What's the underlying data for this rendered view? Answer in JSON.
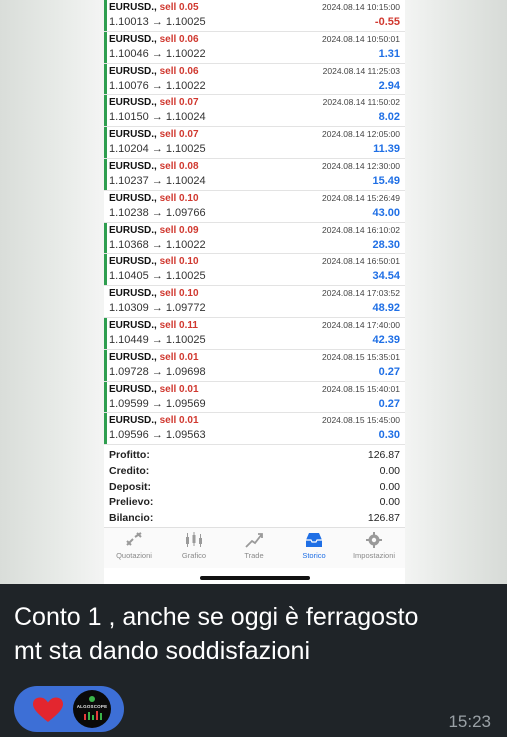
{
  "trades": [
    {
      "symbol": "EURUSD.,",
      "side": "sell 0.05",
      "prices": "1.10013 → 1.10025",
      "date": "2024.08.14 10:15:00",
      "profit": "-0.55",
      "profit_color": "#d0382f",
      "bar_color": "#2e9e4f"
    },
    {
      "symbol": "EURUSD.,",
      "side": "sell 0.06",
      "prices": "1.10046 → 1.10022",
      "date": "2024.08.14 10:50:01",
      "profit": "1.31",
      "profit_color": "#1f6fe5",
      "bar_color": "#2e9e4f"
    },
    {
      "symbol": "EURUSD.,",
      "side": "sell 0.06",
      "prices": "1.10076 → 1.10022",
      "date": "2024.08.14 11:25:03",
      "profit": "2.94",
      "profit_color": "#1f6fe5",
      "bar_color": "#2e9e4f"
    },
    {
      "symbol": "EURUSD.,",
      "side": "sell 0.07",
      "prices": "1.10150 → 1.10024",
      "date": "2024.08.14 11:50:02",
      "profit": "8.02",
      "profit_color": "#1f6fe5",
      "bar_color": "#2e9e4f"
    },
    {
      "symbol": "EURUSD.,",
      "side": "sell 0.07",
      "prices": "1.10204 → 1.10025",
      "date": "2024.08.14 12:05:00",
      "profit": "11.39",
      "profit_color": "#1f6fe5",
      "bar_color": "#2e9e4f"
    },
    {
      "symbol": "EURUSD.,",
      "side": "sell 0.08",
      "prices": "1.10237 → 1.10024",
      "date": "2024.08.14 12:30:00",
      "profit": "15.49",
      "profit_color": "#1f6fe5",
      "bar_color": "#2e9e4f"
    },
    {
      "symbol": "EURUSD.,",
      "side": "sell 0.10",
      "prices": "1.10238 → 1.09766",
      "date": "2024.08.14 15:26:49",
      "profit": "43.00",
      "profit_color": "#1f6fe5",
      "bar_color": "#ffffff"
    },
    {
      "symbol": "EURUSD.,",
      "side": "sell 0.09",
      "prices": "1.10368 → 1.10022",
      "date": "2024.08.14 16:10:02",
      "profit": "28.30",
      "profit_color": "#1f6fe5",
      "bar_color": "#2e9e4f"
    },
    {
      "symbol": "EURUSD.,",
      "side": "sell 0.10",
      "prices": "1.10405 → 1.10025",
      "date": "2024.08.14 16:50:01",
      "profit": "34.54",
      "profit_color": "#1f6fe5",
      "bar_color": "#2e9e4f"
    },
    {
      "symbol": "EURUSD.,",
      "side": "sell 0.10",
      "prices": "1.10309 → 1.09772",
      "date": "2024.08.14 17:03:52",
      "profit": "48.92",
      "profit_color": "#1f6fe5",
      "bar_color": "#ffffff"
    },
    {
      "symbol": "EURUSD.,",
      "side": "sell 0.11",
      "prices": "1.10449 → 1.10025",
      "date": "2024.08.14 17:40:00",
      "profit": "42.39",
      "profit_color": "#1f6fe5",
      "bar_color": "#2e9e4f"
    },
    {
      "symbol": "EURUSD.,",
      "side": "sell 0.01",
      "prices": "1.09728 → 1.09698",
      "date": "2024.08.15 15:35:01",
      "profit": "0.27",
      "profit_color": "#1f6fe5",
      "bar_color": "#2e9e4f"
    },
    {
      "symbol": "EURUSD.,",
      "side": "sell 0.01",
      "prices": "1.09599 → 1.09569",
      "date": "2024.08.15 15:40:01",
      "profit": "0.27",
      "profit_color": "#1f6fe5",
      "bar_color": "#2e9e4f"
    },
    {
      "symbol": "EURUSD.,",
      "side": "sell 0.01",
      "prices": "1.09596 → 1.09563",
      "date": "2024.08.15 15:45:00",
      "profit": "0.30",
      "profit_color": "#1f6fe5",
      "bar_color": "#2e9e4f"
    }
  ],
  "summary": [
    {
      "label": "Profitto:",
      "value": "126.87"
    },
    {
      "label": "Credito:",
      "value": "0.00"
    },
    {
      "label": "Deposit:",
      "value": "0.00"
    },
    {
      "label": "Prelievo:",
      "value": "0.00"
    },
    {
      "label": "Bilancio:",
      "value": "126.87"
    }
  ],
  "tabs": [
    {
      "label": "Quotazioni",
      "icon": "quotes-icon",
      "active": false
    },
    {
      "label": "Grafico",
      "icon": "chart-icon",
      "active": false
    },
    {
      "label": "Trade",
      "icon": "trade-icon",
      "active": false
    },
    {
      "label": "Storico",
      "icon": "history-icon",
      "active": true
    },
    {
      "label": "Impostazioni",
      "icon": "gear-icon",
      "active": false
    }
  ],
  "message": {
    "caption_line1": "Conto 1 , anche se oggi è ferragosto",
    "caption_line2": "mt sta dando soddisfazioni",
    "time": "15:23",
    "reaction_icon": "heart-icon",
    "avatar_text": "ALGOSCOPE"
  },
  "colors": {
    "accent": "#1f6fe5",
    "loss": "#d0382f",
    "win_bar": "#2e9e4f",
    "bubble": "#3d6fd6"
  }
}
